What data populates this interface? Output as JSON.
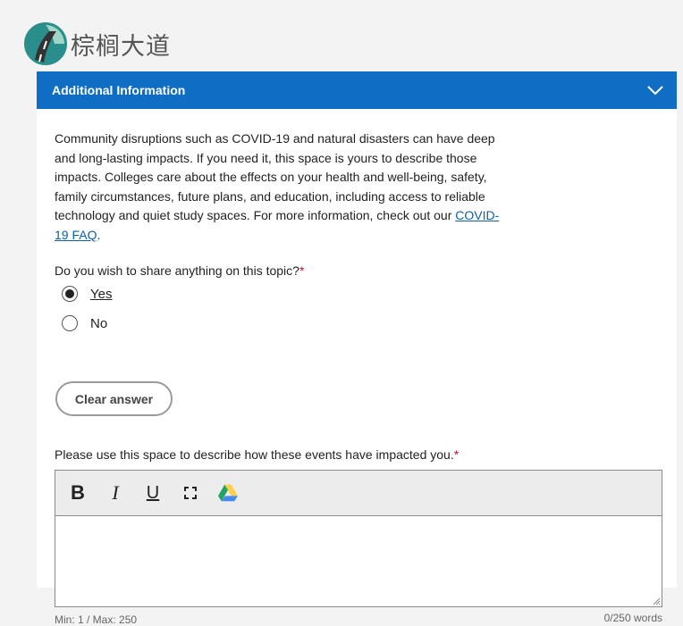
{
  "logo": {
    "text": "棕榈大道"
  },
  "section": {
    "title": "Additional Information",
    "intro_text": "Community disruptions such as COVID-19 and natural disasters can have deep and long-lasting impacts. If you need it, this space is yours to describe those impacts. Colleges care about the effects on your health and well-being, safety, family circumstances, future plans, and education, including access to reliable technology and quiet study spaces. For more information, check out our ",
    "intro_link": "COVID-19 FAQ",
    "intro_end": "."
  },
  "question": {
    "label": "Do you wish to share anything on this topic?",
    "required_mark": "*",
    "options": [
      {
        "label": "Yes",
        "selected": true
      },
      {
        "label": "No",
        "selected": false
      }
    ],
    "clear_label": "Clear answer"
  },
  "description": {
    "label": "Please use this space to describe how these events have impacted you.",
    "required_mark": "*",
    "value": "",
    "toolbar": {
      "bold": "B",
      "italic": "I",
      "underline": "U"
    },
    "min_max": "Min: 1 / Max: 250",
    "word_count": "0/250 words"
  },
  "colors": {
    "header_bg": "#0f6ec3",
    "required": "#c8102e",
    "link": "#0f5fa3",
    "drive_green": "#1fa463",
    "drive_yellow": "#ffd04b",
    "drive_blue": "#4688f4"
  }
}
